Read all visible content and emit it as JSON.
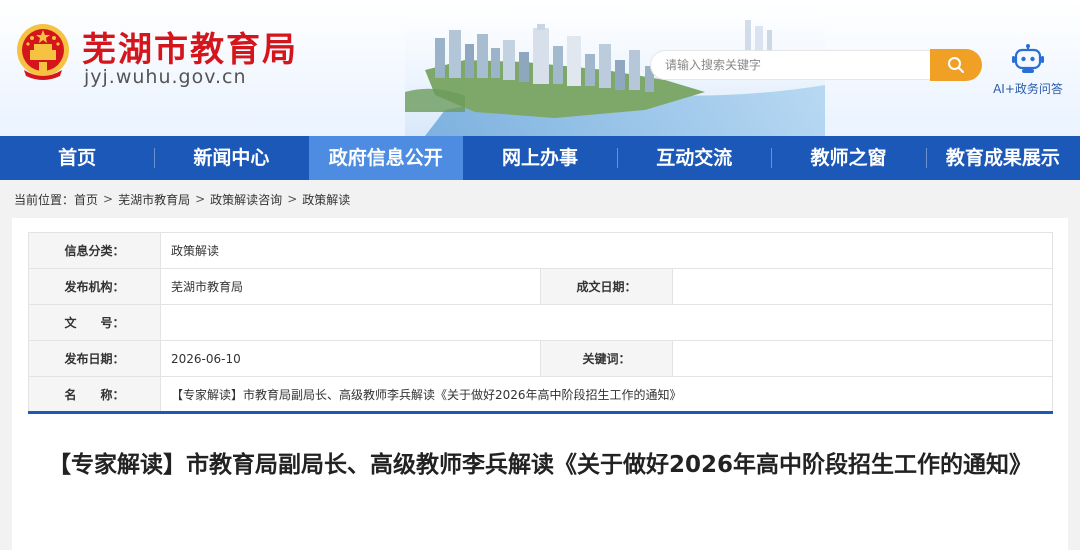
{
  "header": {
    "site_name": "芜湖市教育局",
    "site_domain": "jyj.wuhu.gov.cn",
    "emblem_icon": "national-emblem-icon",
    "search_placeholder": "请输入搜索关键字",
    "search_icon": "search-icon",
    "ai_label": "AI+政务问答",
    "ai_icon": "robot-icon",
    "colors": {
      "title_red": "#d4151b",
      "search_orange": "#f0a025",
      "nav_blue": "#1b58b8",
      "nav_active": "#4d8ce0"
    }
  },
  "nav": {
    "items": [
      {
        "label": "首页"
      },
      {
        "label": "新闻中心"
      },
      {
        "label": "政府信息公开"
      },
      {
        "label": "网上办事"
      },
      {
        "label": "互动交流"
      },
      {
        "label": "教师之窗"
      },
      {
        "label": "教育成果展示"
      }
    ],
    "active_index": 2
  },
  "breadcrumb": {
    "prefix": "当前位置：",
    "items": [
      "首页",
      "芜湖市教育局",
      "政策解读咨询",
      "政策解读"
    ],
    "separator": ">"
  },
  "info": {
    "category_label": "信息分类：",
    "category_value": "政策解读",
    "publisher_label": "发布机构：",
    "publisher_value": "芜湖市教育局",
    "doc_date_label": "成文日期：",
    "doc_date_value": "",
    "doc_no_label": "文　　号：",
    "doc_no_value": "",
    "publish_date_label": "发布日期：",
    "publish_date_value": "2026-06-10",
    "keywords_label": "关键词：",
    "keywords_value": "",
    "name_label": "名　　称：",
    "name_value": "【专家解读】市教育局副局长、高级教师李兵解读《关于做好2026年高中阶段招生工作的通知》"
  },
  "article": {
    "title": "【专家解读】市教育局副局长、高级教师李兵解读《关于做好2026年高中阶段招生工作的通知》"
  }
}
